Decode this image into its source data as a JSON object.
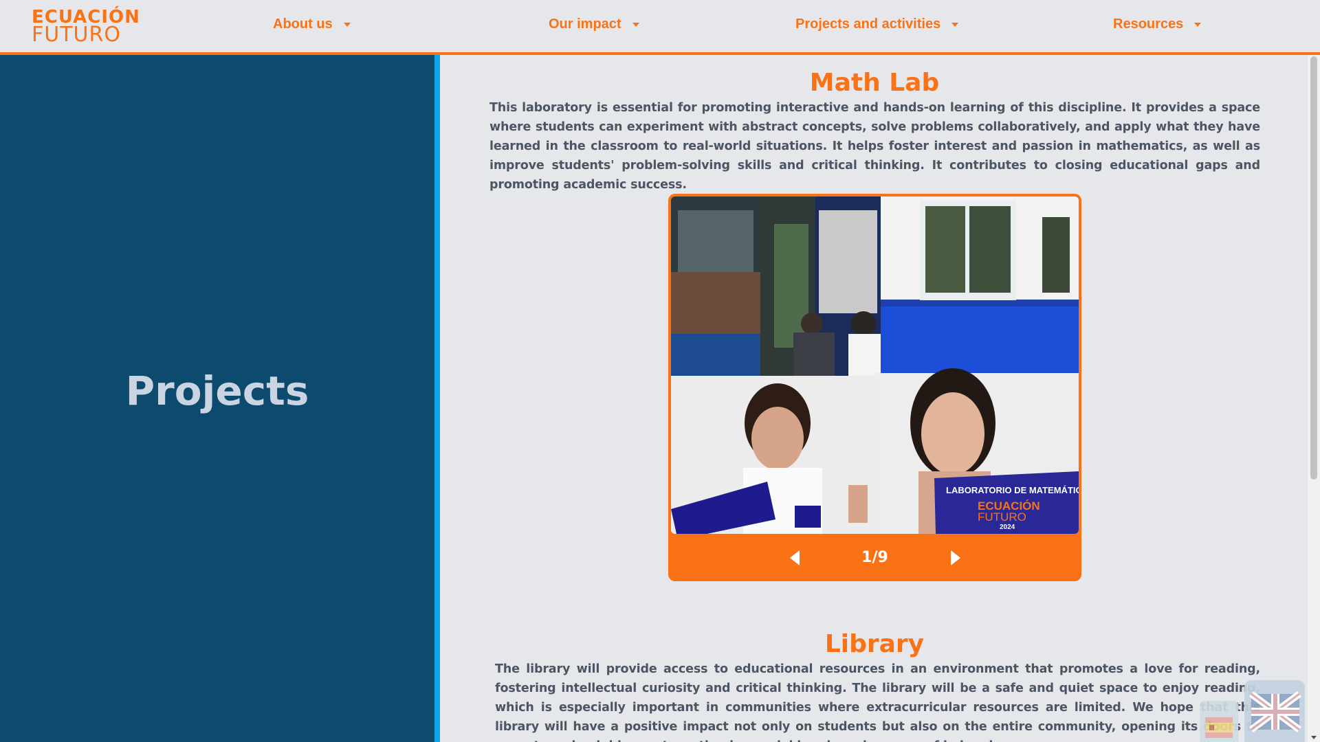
{
  "brand": {
    "line1": "ECUACIÓN",
    "line2": "FUTURO"
  },
  "nav": [
    {
      "label": "About us"
    },
    {
      "label": "Our impact"
    },
    {
      "label": "Projects and activities"
    },
    {
      "label": "Resources"
    }
  ],
  "sidebar": {
    "title": "Projects"
  },
  "sections": [
    {
      "title": "Math Lab",
      "text": "This laboratory is essential for promoting interactive and hands-on learning of this discipline. It provides a space where students can experiment with abstract concepts, solve problems collaboratively, and apply what they have learned in the classroom to real-world situations. It helps foster interest and passion in mathematics, as well as improve students' problem-solving skills and critical thinking. It contributes to closing educational gaps and promoting academic success."
    },
    {
      "title": "Library",
      "text": "The library will provide access to educational resources in an environment that promotes a love for reading, fostering intellectual curiosity and critical thinking. The library will be a safe and quiet space to enjoy reading, which is especially important in communities where extracurricular resources are limited. We hope that this library will have a positive impact not only on students but also on the entire community, opening its doors to parents and neighbors, strengthening social bonds and a sense of belonging."
    }
  ],
  "carousel": {
    "counter": "1/9",
    "sign_text": "LABORATORIO DE MATEMÁTICAS",
    "sign_brand": "ECUACIÓN",
    "sign_brand2": "FUTURO",
    "sign_year": "2024"
  },
  "colors": {
    "accent": "#f97316",
    "sidebar": "#0c4a6e",
    "sidebar_border": "#0ea5e9",
    "page_bg": "#e5e7eb",
    "text": "#4b5563"
  },
  "icons": [
    "caret-down-icon",
    "arrow-left-icon",
    "arrow-right-icon",
    "spain-flag-icon",
    "uk-flag-icon"
  ]
}
